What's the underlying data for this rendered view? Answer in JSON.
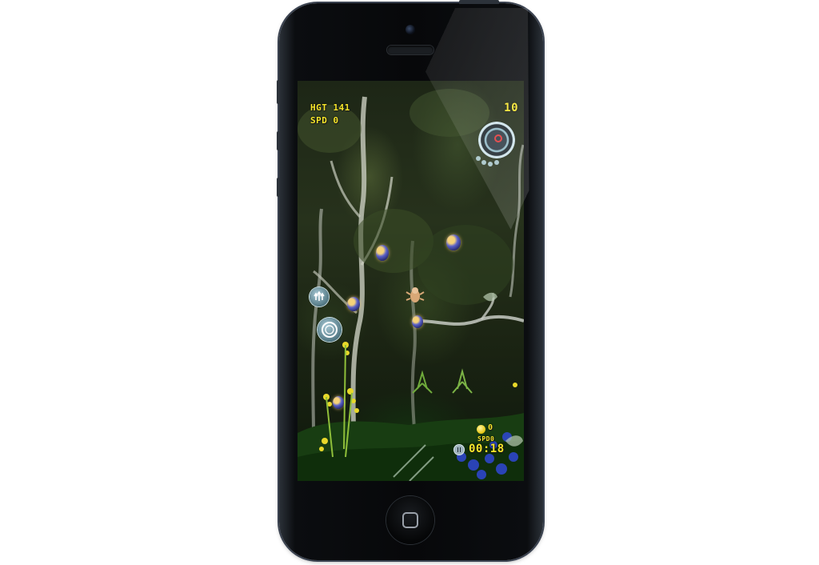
{
  "hud": {
    "height_label": "HGT",
    "height_value": "141",
    "speed_label": "SPD",
    "speed_value": "0",
    "score": "10",
    "bottom_count": "0",
    "bottom_speed_label": "SPD",
    "bottom_speed_value": "0",
    "timer": "00:18"
  },
  "icons": {
    "camera": "camera-icon",
    "home": "home-button-icon",
    "gauge": "speed-gauge-icon",
    "boost": "boost-arrows-icon",
    "action": "action-ring-icon",
    "pause": "pause-icon",
    "coin": "coin-icon",
    "player": "bug-character-icon",
    "orb": "orb-icon"
  },
  "colors": {
    "hud_text": "#f6e62a",
    "gauge_accent": "#e2383a",
    "control_tint": "#8fb7c4"
  }
}
